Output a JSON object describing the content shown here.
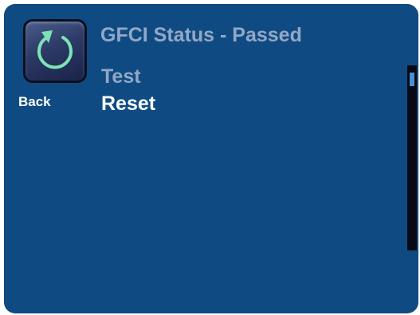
{
  "back_button": {
    "label": "Back",
    "icon": "back-arrow-icon"
  },
  "title": "GFCI Status - Passed",
  "menu": {
    "items": [
      {
        "label": "Test",
        "state": "dimmed"
      },
      {
        "label": "Reset",
        "state": "active"
      }
    ]
  },
  "scrollbar": {
    "position": 0.0
  },
  "colors": {
    "background": "#0f4b82",
    "title_text": "#93a7c6",
    "active_text": "#ffffff",
    "icon_arrow": "#7de3b4"
  }
}
